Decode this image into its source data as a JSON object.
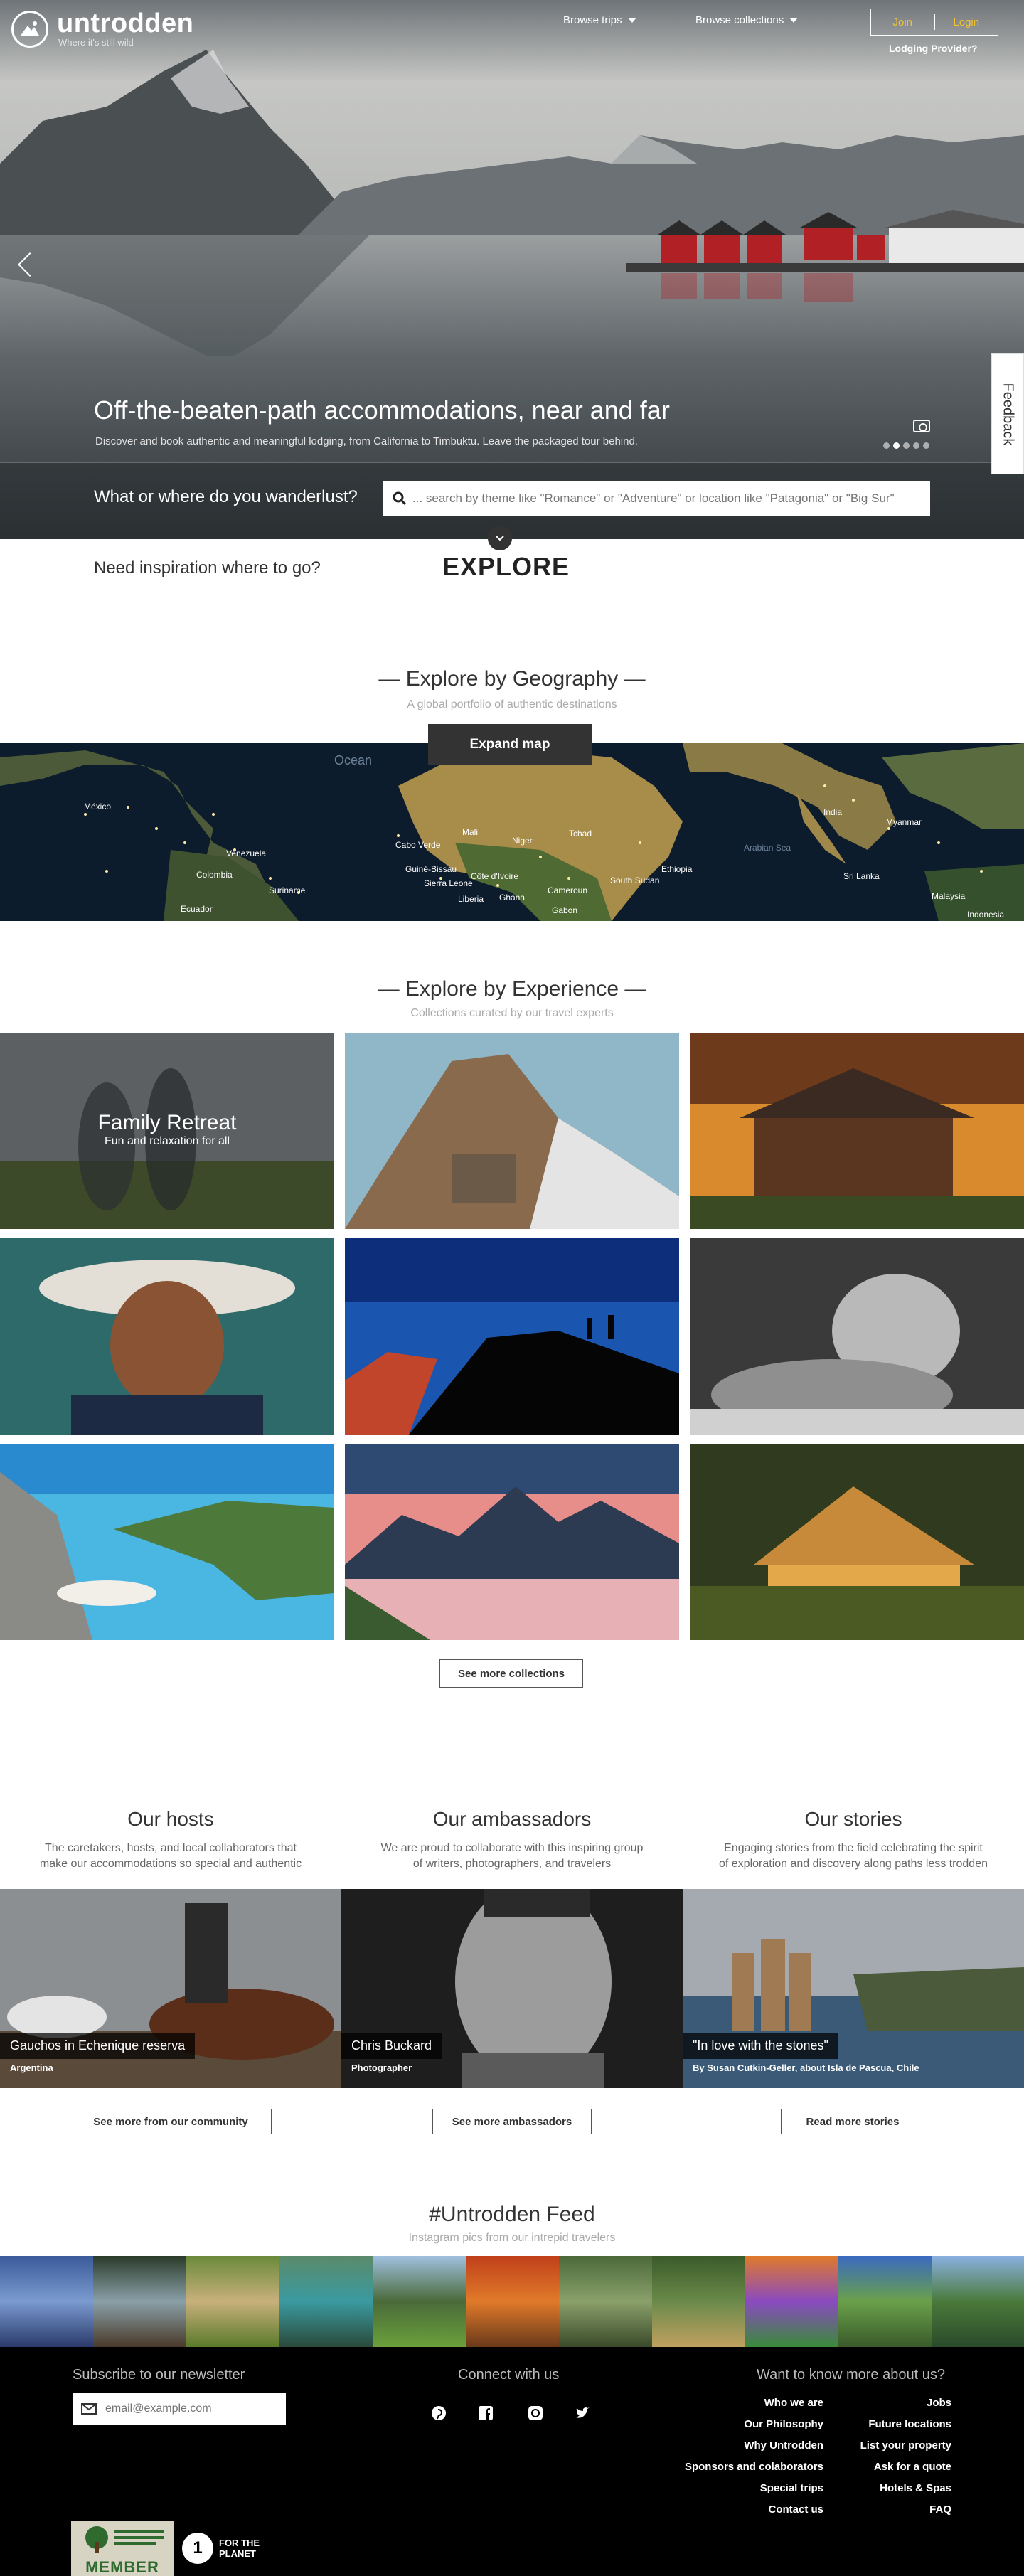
{
  "brand": {
    "name": "untrodden",
    "tagline": "Where it's still wild"
  },
  "nav": {
    "browse_trips": "Browse trips",
    "browse_collections": "Browse collections",
    "join": "Join",
    "login": "Login",
    "lodging_provider": "Lodging Provider?"
  },
  "hero": {
    "title": "Off-the-beaten-path accommodations, near and far",
    "subtitle": "Discover and book authentic and meaningful lodging, from California to Timbuktu. Leave the packaged tour behind.",
    "search_question": "What or where do you wanderlust?",
    "search_placeholder": "... search by theme like \"Romance\" or \"Adventure\" or location like \"Patagonia\" or \"Big Sur\""
  },
  "feedback": "Feedback",
  "inspiration": {
    "text": "Need inspiration where to go?",
    "explore": "EXPLORE"
  },
  "geography": {
    "title": "— Explore by Geography —",
    "subtitle": "A global portfolio of authentic destinations",
    "expand": "Expand map",
    "labels": [
      "Ocean",
      "México",
      "Venezuela",
      "Colombia",
      "Suriname",
      "Ecuador",
      "Cabo Verde",
      "Guiné-Bissau",
      "Sierra Leone",
      "Liberia",
      "Côte d'Ivoire",
      "Ghana",
      "Cameroun",
      "Gabon",
      "South Sudan",
      "Ethiopia",
      "India",
      "Myanmar",
      "Sri Lanka",
      "Malaysia",
      "Indonesia",
      "Arabian Sea",
      "Niger",
      "Mali",
      "Tchad"
    ]
  },
  "experience": {
    "title": "— Explore by Experience —",
    "subtitle": "Collections curated by our travel experts",
    "featured_title": "Family Retreat",
    "featured_subtitle": "Fun and relaxation for all",
    "see_more": "See more collections"
  },
  "community": {
    "hosts": {
      "title": "Our hosts",
      "desc_1": "The caretakers, hosts, and local collaborators that",
      "desc_2": "make our accommodations so special and authentic",
      "tag": "Gauchos in Echenique reserva",
      "meta": "Argentina",
      "button": "See more from our community"
    },
    "ambassadors": {
      "title": "Our ambassadors",
      "desc_1": "We are proud to collaborate with this inspiring group",
      "desc_2": "of writers, photographers, and travelers",
      "tag": "Chris Buckard",
      "meta": "Photographer",
      "button": "See more ambassadors"
    },
    "stories": {
      "title": "Our stories",
      "desc_1": "Engaging stories from the field celebrating the spirit",
      "desc_2": "of exploration and discovery along paths less trodden",
      "tag": "\"In love with the stones\"",
      "meta": "By Susan Cutkin-Geller, about Isla de Pascua, Chile",
      "button": "Read more stories"
    }
  },
  "feed": {
    "title": "#Untrodden Feed",
    "subtitle": "Instagram pics from our intrepid travelers"
  },
  "footer": {
    "newsletter": "Subscribe to our newsletter",
    "email_placeholder": "email@example.com",
    "connect": "Connect with us",
    "more_about": "Want to know more about us?",
    "links_left": [
      "Who we are",
      "Our Philosophy",
      "Why Untrodden",
      "Sponsors and colaborators",
      "Special trips",
      "Contact us"
    ],
    "links_right": [
      "Jobs",
      "Future locations",
      "List your property",
      "Ask for a quote",
      "Hotels & Spas",
      "FAQ"
    ],
    "badge_member": "MEMBER",
    "badge_planet": "FOR THE PLANET"
  }
}
